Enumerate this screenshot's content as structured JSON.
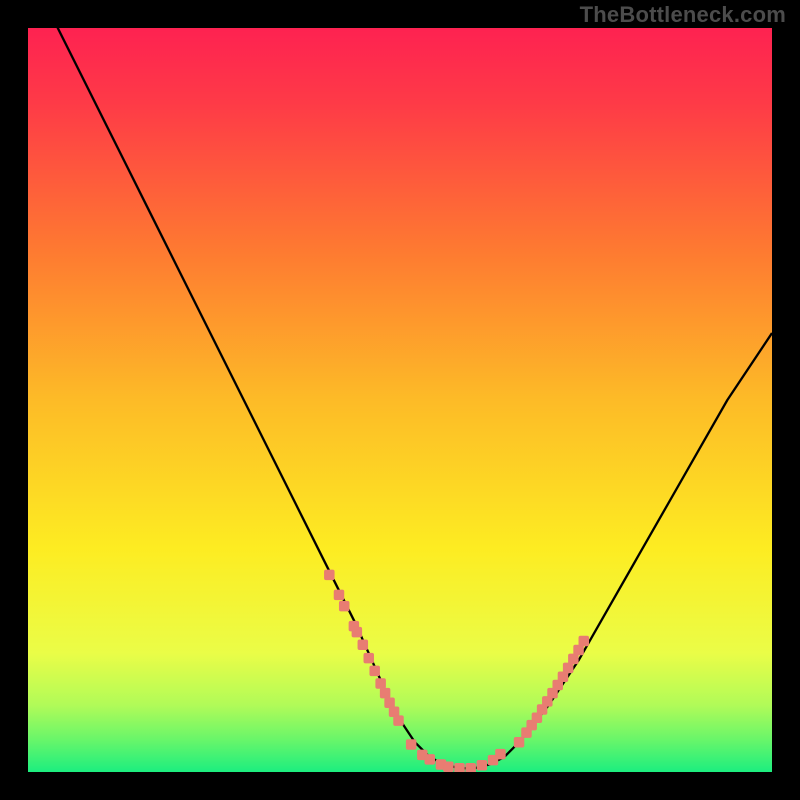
{
  "watermark": "TheBottleneck.com",
  "colors": {
    "frame": "#000000",
    "curve": "#000000",
    "marker_fill": "#e87d72",
    "marker_stroke": "#e87d72",
    "gradient_top": "#fe2251",
    "gradient_mid1": "#fe8d2d",
    "gradient_mid2": "#fdec22",
    "gradient_low": "#eafd47",
    "gradient_bottom": "#1cee7f"
  },
  "chart_data": {
    "type": "line",
    "title": "",
    "xlabel": "",
    "ylabel": "",
    "xlim": [
      0,
      100
    ],
    "ylim": [
      0,
      100
    ],
    "series": [
      {
        "name": "curve",
        "x": [
          0,
          4,
          8,
          12,
          16,
          20,
          24,
          28,
          32,
          36,
          40,
          44,
          48,
          50,
          52,
          54,
          56,
          58,
          60,
          62,
          64,
          66,
          70,
          74,
          78,
          82,
          86,
          90,
          94,
          98,
          100
        ],
        "y": [
          108,
          100,
          92,
          84,
          76,
          68,
          60,
          52,
          44,
          36,
          28,
          20,
          11,
          7,
          4,
          2,
          1,
          0.5,
          0.5,
          1,
          2,
          4,
          9,
          15,
          22,
          29,
          36,
          43,
          50,
          56,
          59
        ]
      }
    ],
    "markers_left": {
      "x": [
        40.5,
        41.8,
        42.5,
        43.8,
        44.2,
        45.0,
        45.8,
        46.6,
        47.4,
        48.0,
        48.6,
        49.2,
        49.8
      ],
      "y": [
        26.5,
        23.8,
        22.3,
        19.6,
        18.8,
        17.1,
        15.3,
        13.6,
        11.9,
        10.6,
        9.3,
        8.1,
        6.9
      ]
    },
    "markers_bottom": {
      "x": [
        51.5,
        53.0,
        54.0,
        55.5,
        56.5,
        58.0,
        59.5,
        61.0,
        62.5,
        63.5
      ],
      "y": [
        3.7,
        2.3,
        1.7,
        1.0,
        0.7,
        0.5,
        0.5,
        0.9,
        1.6,
        2.4
      ]
    },
    "markers_right": {
      "x": [
        66.0,
        67.0,
        67.7,
        68.4,
        69.1,
        69.8,
        70.5,
        71.2,
        71.9,
        72.6,
        73.3,
        74.0,
        74.7
      ],
      "y": [
        4.0,
        5.3,
        6.3,
        7.3,
        8.4,
        9.5,
        10.6,
        11.7,
        12.8,
        14.0,
        15.2,
        16.4,
        17.6
      ]
    }
  }
}
